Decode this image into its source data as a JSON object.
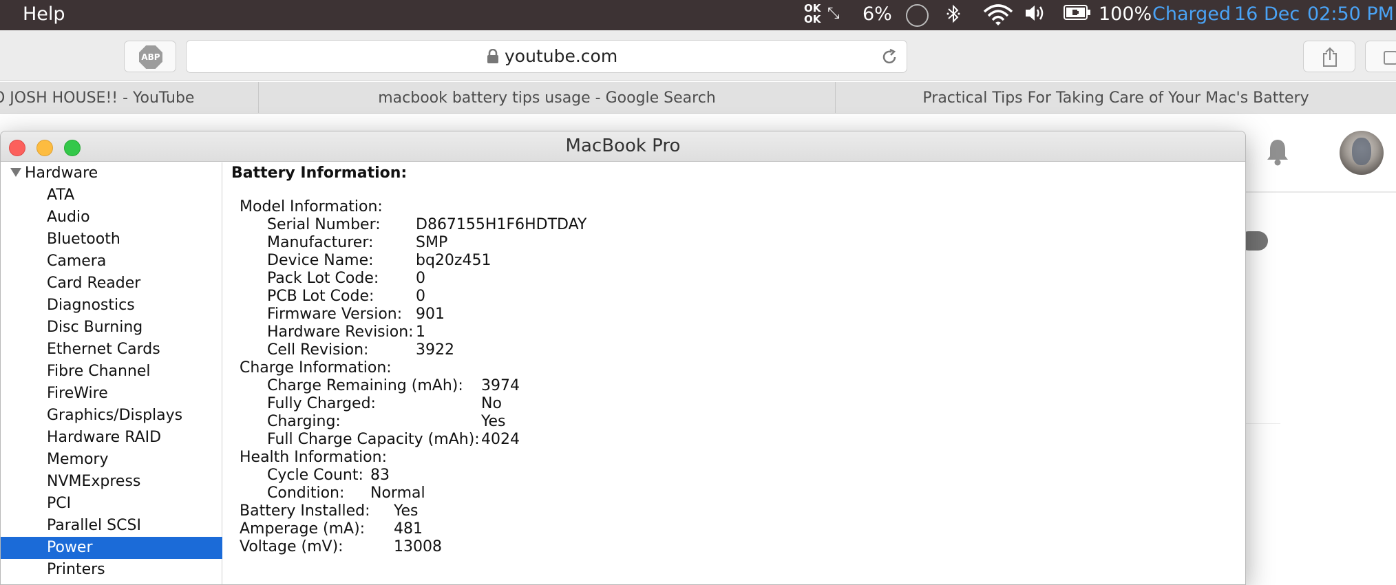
{
  "menubar": {
    "app_menu": "Help",
    "network_status": [
      "OK",
      "OK"
    ],
    "network_arrows_icon": "up-down-arrows-icon",
    "cpu_percent": "6%",
    "battery_percent": "100%",
    "battery_status": "Charged",
    "date": "16 Dec",
    "time": "02:50 PM",
    "accent_color": "#4aa3f5"
  },
  "toolbar": {
    "adblock_label": "ABP",
    "address": "youtube.com"
  },
  "tabs": [
    {
      "title": "O JOSH HOUSE!! - YouTube"
    },
    {
      "title": "macbook battery tips usage - Google Search"
    },
    {
      "title": "Practical Tips For Taking Care of Your Mac's Battery"
    }
  ],
  "window": {
    "title": "MacBook Pro"
  },
  "sidebar": {
    "root": "Hardware",
    "items": [
      {
        "label": "ATA"
      },
      {
        "label": "Audio"
      },
      {
        "label": "Bluetooth"
      },
      {
        "label": "Camera"
      },
      {
        "label": "Card Reader"
      },
      {
        "label": "Diagnostics"
      },
      {
        "label": "Disc Burning"
      },
      {
        "label": "Ethernet Cards"
      },
      {
        "label": "Fibre Channel"
      },
      {
        "label": "FireWire"
      },
      {
        "label": "Graphics/Displays"
      },
      {
        "label": "Hardware RAID"
      },
      {
        "label": "Memory"
      },
      {
        "label": "NVMExpress"
      },
      {
        "label": "PCI"
      },
      {
        "label": "Parallel SCSI"
      },
      {
        "label": "Power"
      },
      {
        "label": "Printers"
      }
    ],
    "selected": "Power",
    "selected_color": "#1b6bd8"
  },
  "detail": {
    "heading": "Battery Information:",
    "model": {
      "heading": "Model Information:",
      "serial_label": "Serial Number:",
      "serial": "D867155H1F6HDTDAY",
      "manufacturer_label": "Manufacturer:",
      "manufacturer": "SMP",
      "device_label": "Device Name:",
      "device": "bq20z451",
      "pack_lot_label": "Pack Lot Code:",
      "pack_lot": "0",
      "pcb_lot_label": "PCB Lot Code:",
      "pcb_lot": "0",
      "firmware_label": "Firmware Version:",
      "firmware": "901",
      "hw_rev_label": "Hardware Revision:",
      "hw_rev": "1",
      "cell_rev_label": "Cell Revision:",
      "cell_rev": "3922"
    },
    "charge": {
      "heading": "Charge Information:",
      "remaining_label": "Charge Remaining (mAh):",
      "remaining": "3974",
      "fully_charged_label": "Fully Charged:",
      "fully_charged": "No",
      "charging_label": "Charging:",
      "charging": "Yes",
      "full_capacity_label": "Full Charge Capacity (mAh):",
      "full_capacity": "4024"
    },
    "health": {
      "heading": "Health Information:",
      "cycle_label": "Cycle Count:",
      "cycle": "83",
      "condition_label": "Condition:",
      "condition": "Normal"
    },
    "installed_label": "Battery Installed:",
    "installed": "Yes",
    "amperage_label": "Amperage (mA):",
    "amperage": "481",
    "voltage_label": "Voltage (mV):",
    "voltage": "13008"
  }
}
